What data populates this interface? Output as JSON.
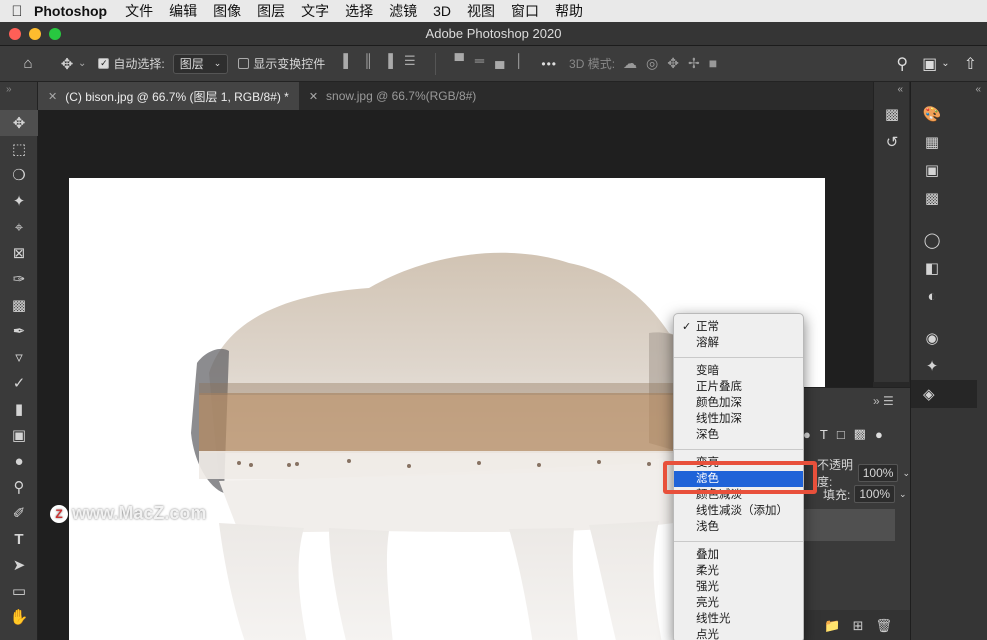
{
  "menubar": {
    "app_name": "Photoshop",
    "items": [
      "文件",
      "编辑",
      "图像",
      "图层",
      "文字",
      "选择",
      "滤镜",
      "3D",
      "视图",
      "窗口",
      "帮助"
    ]
  },
  "window": {
    "title": "Adobe Photoshop 2020"
  },
  "options_bar": {
    "auto_select_label": "自动选择:",
    "auto_select_value": "图层",
    "show_transform_label": "显示变换控件",
    "more_label": "•••",
    "mode_3d_label": "3D 模式:"
  },
  "tabs": [
    {
      "label": "(C) bison.jpg @ 66.7% (图层 1, RGB/8#) *",
      "active": true
    },
    {
      "label": "snow.jpg @ 66.7%(RGB/8#)",
      "active": false
    }
  ],
  "watermark": {
    "logo": "Z",
    "text": "www.MacZ.com"
  },
  "layers_panel": {
    "opacity_label": "不透明度:",
    "opacity_value": "100%",
    "fill_label": "填充:",
    "fill_value": "100%"
  },
  "blend_menu": {
    "checked": "正常",
    "selected": "滤色",
    "groups": [
      [
        "正常",
        "溶解"
      ],
      [
        "变暗",
        "正片叠底",
        "颜色加深",
        "线性加深",
        "深色"
      ],
      [
        "变亮",
        "滤色",
        "颜色减淡",
        "线性减淡（添加）",
        "浅色"
      ],
      [
        "叠加",
        "柔光",
        "强光",
        "亮光",
        "线性光",
        "点光"
      ]
    ]
  },
  "colors": {
    "highlight_border": "#e8503b",
    "menu_selection": "#1f63d8",
    "canvas_bg": "#1f1f1f",
    "panel_bg": "#3a3a3a"
  }
}
